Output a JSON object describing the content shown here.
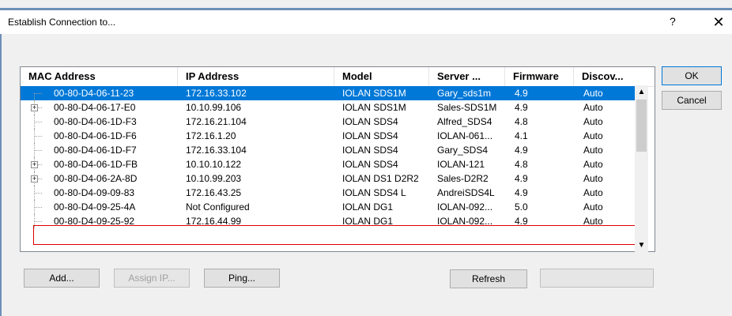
{
  "window": {
    "title": "Establish Connection to...",
    "help_glyph": "?",
    "close_glyph": "✕"
  },
  "columns": [
    "MAC Address",
    "IP Address",
    "Model",
    "Server ...",
    "Firmware",
    "Discov..."
  ],
  "rows": [
    {
      "mac": "00-80-D4-06-11-23",
      "ip": "172.16.33.102",
      "model": "IOLAN SDS1M",
      "server": "Gary_sds1m",
      "fw": "4.9",
      "disc": "Auto",
      "expand": false,
      "selected": true
    },
    {
      "mac": "00-80-D4-06-17-E0",
      "ip": "10.10.99.106",
      "model": "IOLAN SDS1M",
      "server": "Sales-SDS1M",
      "fw": "4.9",
      "disc": "Auto",
      "expand": true
    },
    {
      "mac": "00-80-D4-06-1D-F3",
      "ip": "172.16.21.104",
      "model": "IOLAN SDS4",
      "server": "Alfred_SDS4",
      "fw": "4.8",
      "disc": "Auto",
      "expand": false
    },
    {
      "mac": "00-80-D4-06-1D-F6",
      "ip": "172.16.1.20",
      "model": "IOLAN SDS4",
      "server": "IOLAN-061...",
      "fw": "4.1",
      "disc": "Auto",
      "expand": false
    },
    {
      "mac": "00-80-D4-06-1D-F7",
      "ip": "172.16.33.104",
      "model": "IOLAN SDS4",
      "server": "Gary_SDS4",
      "fw": "4.9",
      "disc": "Auto",
      "expand": false
    },
    {
      "mac": "00-80-D4-06-1D-FB",
      "ip": "10.10.10.122",
      "model": "IOLAN SDS4",
      "server": "IOLAN-121",
      "fw": "4.8",
      "disc": "Auto",
      "expand": true
    },
    {
      "mac": "00-80-D4-06-2A-8D",
      "ip": "10.10.99.203",
      "model": "IOLAN DS1 D2R2",
      "server": "Sales-D2R2",
      "fw": "4.9",
      "disc": "Auto",
      "expand": true
    },
    {
      "mac": "00-80-D4-09-09-83",
      "ip": "172.16.43.25",
      "model": "IOLAN SDS4 L",
      "server": "AndreiSDS4L",
      "fw": "4.9",
      "disc": "Auto",
      "expand": false
    },
    {
      "mac": "00-80-D4-09-25-4A",
      "ip": "Not Configured",
      "model": "IOLAN DG1",
      "server": "IOLAN-092...",
      "fw": "5.0",
      "disc": "Auto",
      "expand": false,
      "outlined": true
    },
    {
      "mac": "00-80-D4-09-25-92",
      "ip": "172.16.44.99",
      "model": "IOLAN DG1",
      "server": "IOLAN-092...",
      "fw": "4.9",
      "disc": "Auto",
      "expand": false
    }
  ],
  "buttons": {
    "ok": "OK",
    "cancel": "Cancel",
    "add": "Add...",
    "assign_ip": "Assign IP...",
    "ping": "Ping...",
    "refresh": "Refresh",
    "blank": ""
  },
  "scroll": {
    "up_glyph": "▲",
    "down_glyph": "▼"
  }
}
